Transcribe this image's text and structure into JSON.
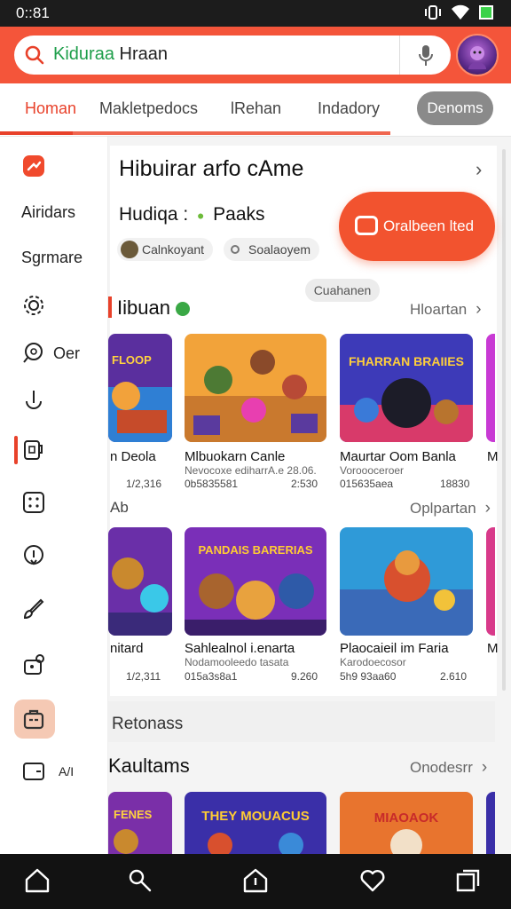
{
  "status": {
    "time": "0::81"
  },
  "search": {
    "value_prefix": "Kiduraa",
    "value_rest": " Hraan"
  },
  "tabs": [
    {
      "label": "Homan"
    },
    {
      "label": "Makletpedocs"
    },
    {
      "label": "lRehan"
    },
    {
      "label": "Indadory"
    },
    {
      "label": "Denoms"
    }
  ],
  "sidebar": {
    "items": [
      {
        "label": "",
        "icon": "tag-icon"
      },
      {
        "label": "Airidars",
        "icon": ""
      },
      {
        "label": "Sgrmare",
        "icon": ""
      },
      {
        "label": "",
        "icon": "gear-icon"
      },
      {
        "label": "Oer",
        "icon": "chat-search-icon"
      },
      {
        "label": "",
        "icon": "info-icon"
      },
      {
        "label": "",
        "icon": "cup-icon"
      },
      {
        "label": "",
        "icon": "grid-icon"
      },
      {
        "label": "",
        "icon": "location-icon"
      },
      {
        "label": "",
        "icon": "brush-icon"
      },
      {
        "label": "",
        "icon": "lock-icon"
      },
      {
        "label": "",
        "icon": "briefcase-icon"
      },
      {
        "label": "A/I",
        "icon": "wallet-icon"
      }
    ]
  },
  "header": {
    "title": "Hibuirar arfo cAme",
    "subtitle": "Hudiqa :",
    "subtitle_tag": "Paaks",
    "chip1": "Calnkoyant",
    "chip2": "Soalaoyem",
    "cta": "Oralbeen lted",
    "floating_chip": "Cuahanen"
  },
  "section1": {
    "title": "Iibuan",
    "more": "Hloartan",
    "games": [
      {
        "title": "n Deola",
        "sub": "",
        "meta_left": "1/2,316",
        "meta_right": ""
      },
      {
        "title": "Mlbuokarn Canle",
        "sub": "Nevocoxe ediharrA.e 28.06.",
        "meta_left": "0b5835581",
        "meta_right": "2:530"
      },
      {
        "title": "Maurtar Oom Banla",
        "sub": "Voroooceroer",
        "meta_left": "015635aea",
        "meta_right": "18830"
      },
      {
        "title": "M",
        "sub": "",
        "meta_left": "",
        "meta_right": ""
      }
    ]
  },
  "section2": {
    "title": "Ab",
    "more": "Oplpartan",
    "games": [
      {
        "title": "nitard",
        "sub": "",
        "meta_left": "1/2,311",
        "meta_right": ""
      },
      {
        "title": "Sahlealnol i.enarta",
        "sub": "Nodamooleedo tasata",
        "meta_left": "015a3s8a1",
        "meta_right": "9.260"
      },
      {
        "title": "Plaocaieil im Faria",
        "sub": "Karodoecosor",
        "meta_left": "5h9 93aa60",
        "meta_right": "2.610"
      },
      {
        "title": "M",
        "sub": "",
        "meta_left": "",
        "meta_right": ""
      }
    ]
  },
  "band": {
    "label": "Retonass"
  },
  "section3": {
    "title": "Kaultams",
    "more": "Onodesrr"
  },
  "thumbs": {
    "s1": [
      "FLOOP",
      "",
      "FHARRAN BRAIIES",
      ""
    ],
    "s2": [
      "",
      "PANDAIS BARERIAS",
      "",
      ""
    ],
    "s3": [
      "FENES",
      "THEY MOUACUS",
      "MIAOAOK",
      ""
    ]
  },
  "colors": {
    "accent": "#e8412a",
    "topbar": "#f4553a"
  }
}
